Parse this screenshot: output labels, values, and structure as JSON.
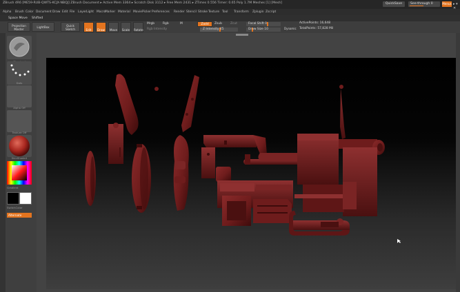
{
  "titlebar": {
    "title": "ZBrush 4R6 [ME59-RUB-QWTS-KCJX-NBQJ]   ZBrush Document   ▸ Active Mem 3364 ▸ Scratch Disk 3112 ▸ Free Mem 2431 ▸ ZTimes 0.556 Timer: 0.65 Poly 1.7M  Meshes [1] [Mesh]",
    "quicksave": "QuickSave",
    "seethrough": "See-through  0",
    "menus_btn": "Menus",
    "window_controls": "▸ ▾ ✕"
  },
  "menubar": [
    "Alpha",
    "Brush",
    "Color",
    "Document",
    "Draw",
    "Edit",
    "File",
    "Layer",
    "Light",
    "Macro",
    "Marker",
    "Material",
    "Movie",
    "Picker",
    "Preferences",
    "Render",
    "Stencil",
    "Stroke",
    "Texture",
    "Tool",
    "Transform",
    "Zplugin",
    "Zscript"
  ],
  "subbar": {
    "spacemove": "Space Move",
    "shifted": "Shifted"
  },
  "toolbar": {
    "projection_master": "Projection Master",
    "lightbox": "LightBox",
    "quick_sketch": "Quick Sketch",
    "edit": "Edit",
    "draw": "Draw",
    "move": "Move",
    "scale": "Scale",
    "rotate": "Rotate",
    "mrgb": "Mrgb",
    "rgb": "Rgb",
    "m": "M",
    "rgb_intensity": "Rgb Intensity",
    "zadd": "Zadd",
    "zsub": "Zsub",
    "zcut": "Zcut",
    "z_intensity": "Z Intensity 45",
    "focal_shift": "Focal Shift 0",
    "draw_size": "Draw Size 10",
    "dynamic": "Dynamic",
    "active_points": "ActivePoints: 16,648",
    "total_points": "TotalPoints: 57,828 Mil"
  },
  "left_shelf": {
    "brush_label": "Standard",
    "stroke_label": "Dots",
    "alpha_label": "Alpha Off",
    "texture_label": "Texture Off",
    "material_label": "SkinShade4",
    "gradient_label": "Gradient",
    "switchcolor_label": "SwitchColor",
    "alternate_label": "Alternate"
  },
  "colors": {
    "accent": "#e3741f",
    "mesh": "#6e1c1c",
    "mesh_highlight": "#8a2a2a",
    "mesh_shadow": "#3d0b0b"
  }
}
